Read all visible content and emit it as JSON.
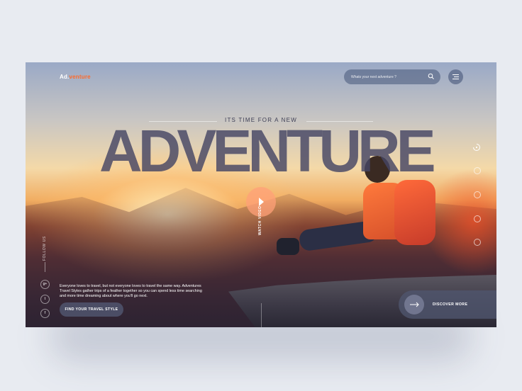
{
  "brand": {
    "logo_prefix": "Ad.",
    "logo_suffix": "venture",
    "accent_color": "#ff6a2b"
  },
  "header": {
    "search_placeholder": "Whats your next adventure ?"
  },
  "hero": {
    "eyebrow": "ITS TIME FOR A NEW",
    "headline": "ADVENTURE",
    "video_label": "WATCH VIDEO",
    "description": "Everyone loves to travel, but not everyone loves to travel the same way. Adventures Travel Styles gather trips of a feather together so you can spend less time searching and more time dreaming about where you'll go next.",
    "cta_label": "FIND YOUR TRAVEL STYLE"
  },
  "social": {
    "follow_label": "FOLLOW US",
    "icons": [
      {
        "name": "google-plus-icon",
        "glyph": "g+"
      },
      {
        "name": "twitter-icon",
        "glyph": "t"
      },
      {
        "name": "facebook-icon",
        "glyph": "f"
      }
    ]
  },
  "slider": {
    "total": 5,
    "active": 1
  },
  "discover": {
    "label": "DISCOVER MORE"
  }
}
